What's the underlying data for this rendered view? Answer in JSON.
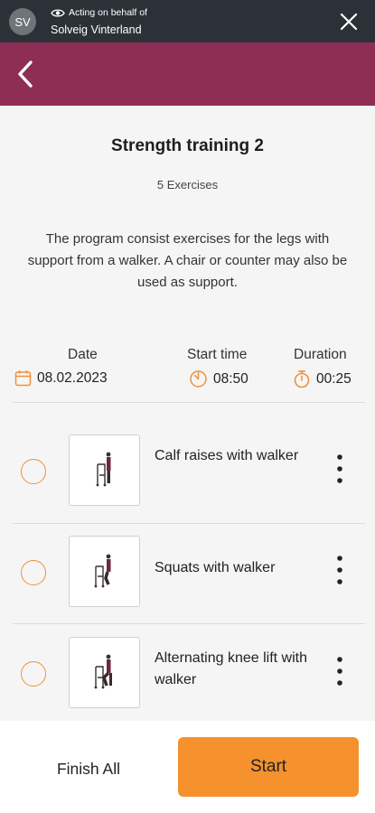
{
  "topbar": {
    "avatar_initials": "SV",
    "acting_label": "Acting on behalf of",
    "acting_name": "Solveig Vinterland"
  },
  "program": {
    "title": "Strength training 2",
    "count_label": "5 Exercises",
    "description": "The program consist exercises for the legs with support from a walker. A chair or counter may also be used as support."
  },
  "meta": {
    "date_label": "Date",
    "date_value": "08.02.2023",
    "start_label": "Start time",
    "start_value": "08:50",
    "duration_label": "Duration",
    "duration_value": "00:25"
  },
  "exercises": [
    {
      "name": "Calf raises with walker",
      "completed": false
    },
    {
      "name": "Squats with walker",
      "completed": false
    },
    {
      "name": "Alternating knee lift with walker",
      "completed": false
    }
  ],
  "footer": {
    "finish_label": "Finish All",
    "start_label": "Start"
  },
  "colors": {
    "topbar": "#2b3137",
    "navbar": "#8f2e55",
    "accent": "#f5922d"
  },
  "icons": {
    "eye": "eye-icon",
    "close": "close-icon",
    "back": "chevron-left-icon",
    "calendar": "calendar-icon",
    "clock": "clock-icon",
    "stopwatch": "stopwatch-icon",
    "more": "more-vertical-icon"
  }
}
